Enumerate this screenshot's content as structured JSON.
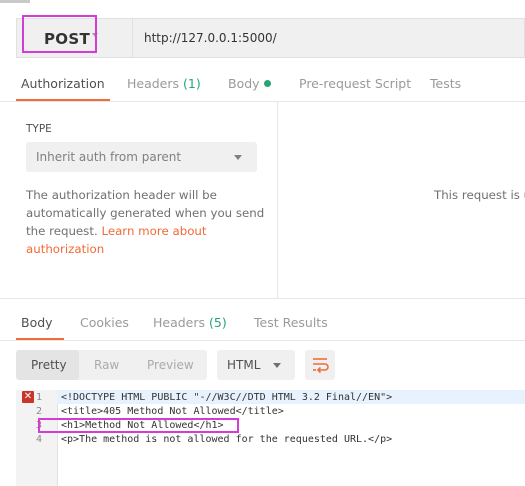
{
  "request": {
    "method": "POST",
    "url": "http://127.0.0.1:5000/"
  },
  "request_tabs": [
    {
      "label": "Authorization",
      "active": true
    },
    {
      "label": "Headers",
      "count": "(1)"
    },
    {
      "label": "Body",
      "indicator": "green-dot"
    },
    {
      "label": "Pre-request Script"
    },
    {
      "label": "Tests"
    }
  ],
  "auth": {
    "type_label": "TYPE",
    "type_value": "Inherit auth from parent",
    "description": "The authorization header will be automatically generated when you send the request.",
    "link_text": "Learn more about authorization",
    "right_message": "This request is u"
  },
  "response_tabs": [
    {
      "label": "Body",
      "active": true
    },
    {
      "label": "Cookies"
    },
    {
      "label": "Headers",
      "count": "(5)"
    },
    {
      "label": "Test Results"
    }
  ],
  "format_buttons": [
    "Pretty",
    "Raw",
    "Preview"
  ],
  "language": "HTML",
  "code_lines": [
    {
      "num": "1",
      "text": "<!DOCTYPE HTML PUBLIC \"-//W3C//DTD HTML 3.2 Final//EN\">"
    },
    {
      "num": "2",
      "text": "<title>405 Method Not Allowed</title>"
    },
    {
      "num": "3",
      "text": "<h1>Method Not Allowed</h1>"
    },
    {
      "num": "4",
      "text": "<p>The method is not allowed for the requested URL.</p>"
    }
  ],
  "colors": {
    "accent": "#f26b3a",
    "count_green": "#26a574",
    "highlight_magenta": "#d43cd8",
    "error_red": "#c9352a"
  },
  "icons": {
    "method_caret": "chevron-down-icon",
    "wrap": "wrap-lines-icon",
    "error": "error-x-icon"
  }
}
